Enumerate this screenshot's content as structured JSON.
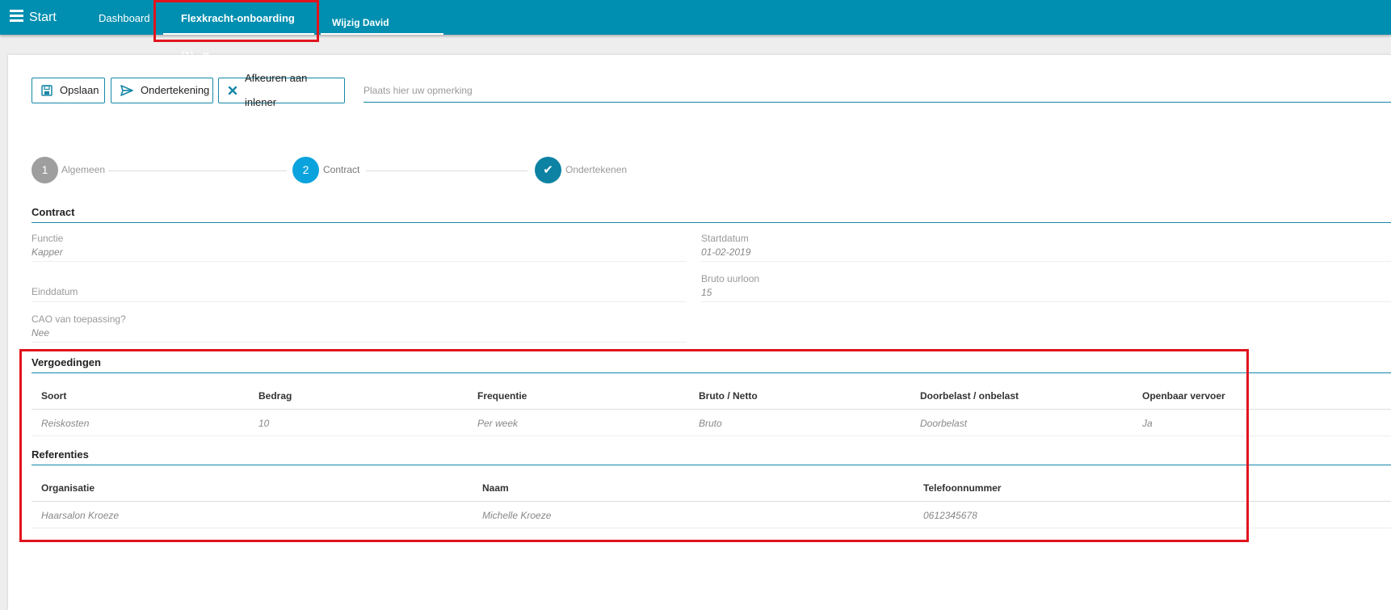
{
  "header": {
    "app_title": "Start",
    "tabs": [
      {
        "label": "Dashboard",
        "closable": false
      },
      {
        "label": "Flexkracht-onboarding (1)",
        "closable": true
      },
      {
        "label": "Wijzig David Molenaar",
        "closable": true
      }
    ],
    "close_glyph": "✖"
  },
  "toolbar": {
    "save_label": "Opslaan",
    "sign_label": "Ondertekening",
    "reject_label": "Afkeuren aan inlener",
    "remark_placeholder": "Plaats hier uw opmerking",
    "icons": {
      "save": "floppy-disk-icon",
      "sign": "paper-plane-icon",
      "reject": "times-icon"
    }
  },
  "stepper": {
    "steps": [
      {
        "marker": "1",
        "label": "Algemeen",
        "state": "inactive"
      },
      {
        "marker": "2",
        "label": "Contract",
        "state": "current"
      },
      {
        "marker": "✔",
        "label": "Ondertekenen",
        "state": "done"
      }
    ]
  },
  "contract": {
    "title": "Contract",
    "functie_label": "Functie",
    "functie_value": "Kapper",
    "startdatum_label": "Startdatum",
    "startdatum_value": "01-02-2019",
    "einddatum_label": "Einddatum",
    "einddatum_value": "",
    "bruto_uurloon_label": "Bruto uurloon",
    "bruto_uurloon_value": "15",
    "cao_label": "CAO van toepassing?",
    "cao_value": "Nee"
  },
  "vergoedingen": {
    "title": "Vergoedingen",
    "columns": [
      "Soort",
      "Bedrag",
      "Frequentie",
      "Bruto / Netto",
      "Doorbelast / onbelast",
      "Openbaar vervoer"
    ],
    "rows": [
      [
        "Reiskosten",
        "10",
        "Per week",
        "Bruto",
        "Doorbelast",
        "Ja"
      ]
    ]
  },
  "referenties": {
    "title": "Referenties",
    "columns": [
      "Organisatie",
      "Naam",
      "Telefoonnummer"
    ],
    "rows": [
      [
        "Haarsalon Kroeze",
        "Michelle Kroeze",
        "0612345678"
      ]
    ]
  },
  "colors": {
    "topbar": "#008fb0",
    "accent": "#1687a7",
    "step_inactive": "#9e9e9e",
    "step_current": "#0ba3dd",
    "step_done": "#0d82a3",
    "highlight": "#e0141e"
  }
}
